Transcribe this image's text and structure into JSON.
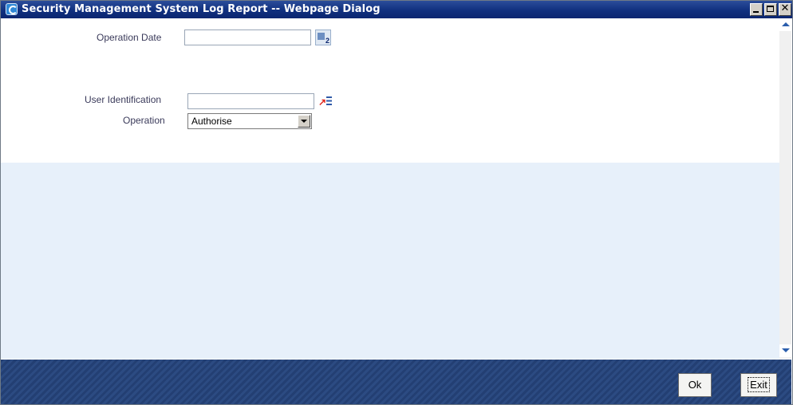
{
  "window": {
    "title": "Security Management System Log Report -- Webpage Dialog",
    "close_glyph": "✕"
  },
  "form": {
    "operation_date_label": "Operation Date",
    "operation_date_value": "",
    "calendar_num": "2",
    "user_identification_label": "User Identification",
    "user_identification_value": "",
    "lov_arrow": "↗",
    "operation_label": "Operation",
    "operation_value": "Authorise"
  },
  "footer": {
    "ok_label": "Ok",
    "exit_label": "Exit"
  },
  "colors": {
    "titlebar": "#10307f",
    "content_bg": "#e7f0fa",
    "footer_bg": "#233f73"
  },
  "icons": [
    "ie-icon",
    "minimize-icon",
    "maximize-icon",
    "close-icon",
    "calendar-icon",
    "lov-icon",
    "dropdown-arrow-icon",
    "scroll-up-icon",
    "scroll-down-icon"
  ]
}
